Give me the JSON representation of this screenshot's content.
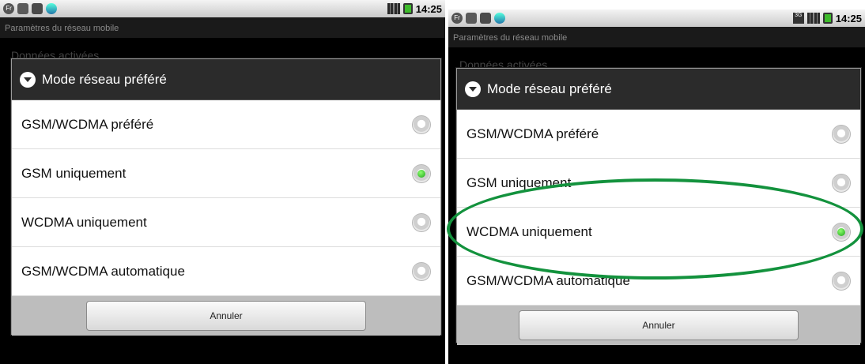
{
  "colors": {
    "accent_green": "#13923d",
    "radio_selected": "#2ec42a"
  },
  "screens": [
    {
      "status": {
        "time": "14:25",
        "left_icons": [
          "fr-icon",
          "usb-icon",
          "sd-card-icon",
          "theme-icon"
        ],
        "right_icons": [
          "signal-icon",
          "battery-icon"
        ]
      },
      "subtitle": "Paramètres du réseau mobile",
      "background_row": "Données activées",
      "dialog": {
        "title": "Mode réseau préféré",
        "options": [
          {
            "label": "GSM/WCDMA préféré",
            "checked": false
          },
          {
            "label": "GSM uniquement",
            "checked": true
          },
          {
            "label": "WCDMA uniquement",
            "checked": false
          },
          {
            "label": "GSM/WCDMA automatique",
            "checked": false
          }
        ],
        "cancel_label": "Annuler"
      }
    },
    {
      "status": {
        "time": "14:25",
        "left_icons": [
          "fr-icon",
          "usb-icon",
          "sd-card-icon",
          "theme-icon"
        ],
        "right_icons": [
          "3g-icon",
          "signal-icon",
          "battery-icon"
        ]
      },
      "subtitle": "Paramètres du réseau mobile",
      "background_row": "Données activées",
      "dialog": {
        "title": "Mode réseau préféré",
        "options": [
          {
            "label": "GSM/WCDMA préféré",
            "checked": false
          },
          {
            "label": "GSM uniquement",
            "checked": false
          },
          {
            "label": "WCDMA uniquement",
            "checked": true
          },
          {
            "label": "GSM/WCDMA automatique",
            "checked": false
          }
        ],
        "cancel_label": "Annuler"
      }
    }
  ]
}
